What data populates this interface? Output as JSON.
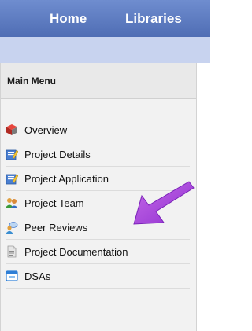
{
  "nav": {
    "home": "Home",
    "libraries": "Libraries"
  },
  "menu": {
    "header": "Main Menu",
    "items": [
      {
        "label": "Overview",
        "icon": "cube-icon"
      },
      {
        "label": "Project Details",
        "icon": "edit-document-icon"
      },
      {
        "label": "Project Application",
        "icon": "edit-document-icon"
      },
      {
        "label": "Project Team",
        "icon": "team-icon"
      },
      {
        "label": "Peer Reviews",
        "icon": "peer-review-icon"
      },
      {
        "label": "Project Documentation",
        "icon": "document-icon"
      },
      {
        "label": "DSAs",
        "icon": "dsa-window-icon"
      }
    ]
  },
  "annotation": {
    "arrow_color": "#a23ad8",
    "arrow": "purple-arrow-icon"
  },
  "colors": {
    "topbar": "#5878c0",
    "stripe": "#c8d3ef",
    "panel": "#f2f2f2"
  }
}
